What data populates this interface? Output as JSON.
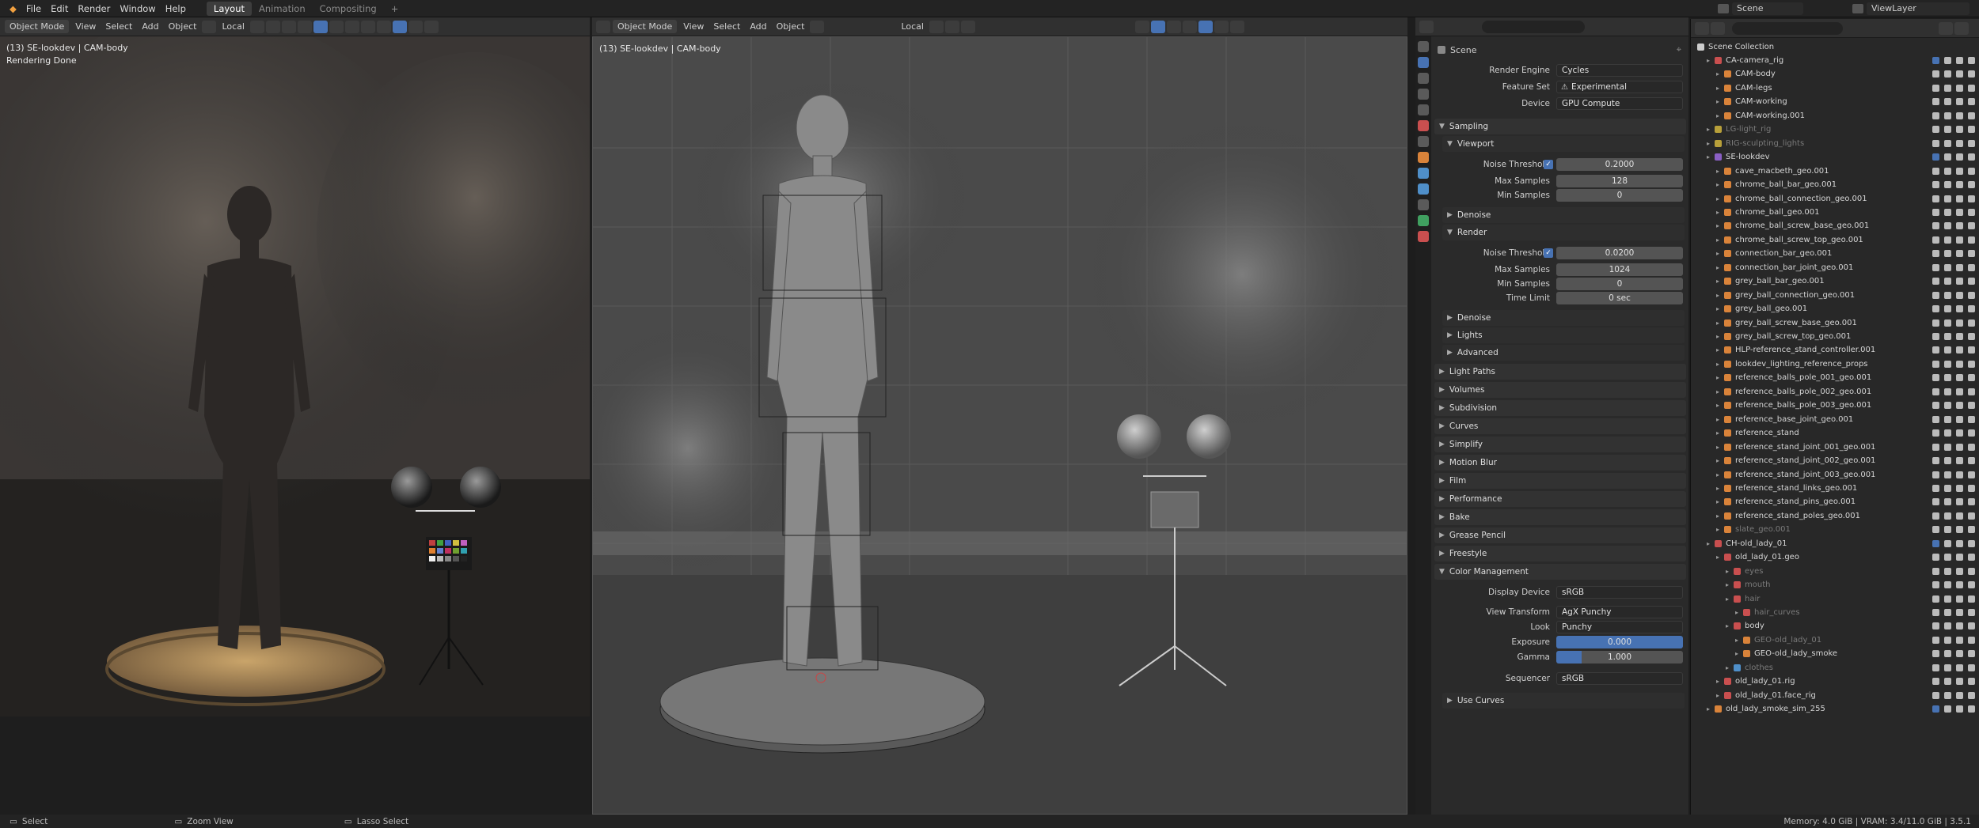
{
  "app": {
    "menus": [
      "File",
      "Edit",
      "Render",
      "Window",
      "Help"
    ],
    "workspaces": [
      "Layout",
      "Animation",
      "Compositing",
      "+"
    ],
    "active_workspace": "Layout",
    "scene_label": "Scene",
    "view_layer_label": "ViewLayer"
  },
  "viewport_left": {
    "mode": "Object Mode",
    "menus": [
      "View",
      "Select",
      "Add",
      "Object"
    ],
    "orientation": "Local",
    "overlay_title": "(13) SE-lookdev | CAM-body",
    "status_text": "Rendering Done"
  },
  "viewport_right": {
    "mode": "Object Mode",
    "menus": [
      "View",
      "Select",
      "Add",
      "Object"
    ],
    "orientation": "Local",
    "overlay_title": "(13) SE-lookdev | CAM-body"
  },
  "properties": {
    "scene_title": "Scene",
    "render_engine_label": "Render Engine",
    "render_engine": "Cycles",
    "feature_set_label": "Feature Set",
    "feature_set": "Experimental",
    "device_label": "Device",
    "device": "GPU Compute",
    "sampling": "Sampling",
    "viewport": "Viewport",
    "noise_threshold_label": "Noise Threshold",
    "vp_noise_threshold": "0.2000",
    "max_samples_label": "Max Samples",
    "vp_max_samples": "128",
    "min_samples_label": "Min Samples",
    "vp_min_samples": "0",
    "denoise": "Denoise",
    "render": "Render",
    "r_noise_threshold": "0.0200",
    "r_max_samples": "1024",
    "r_min_samples": "0",
    "time_limit_label": "Time Limit",
    "time_limit": "0 sec",
    "lights": "Lights",
    "advanced": "Advanced",
    "light_paths": "Light Paths",
    "volumes": "Volumes",
    "subdivision": "Subdivision",
    "curves": "Curves",
    "simplify": "Simplify",
    "motion_blur": "Motion Blur",
    "film": "Film",
    "performance": "Performance",
    "bake": "Bake",
    "grease_pencil": "Grease Pencil",
    "freestyle": "Freestyle",
    "color_management": "Color Management",
    "display_device_label": "Display Device",
    "display_device": "sRGB",
    "view_transform_label": "View Transform",
    "view_transform": "AgX Punchy",
    "look_label": "Look",
    "look": "Punchy",
    "exposure_label": "Exposure",
    "exposure": "0.000",
    "gamma_label": "Gamma",
    "gamma": "1.000",
    "sequencer_label": "Sequencer",
    "sequencer": "sRGB",
    "use_curves": "Use Curves"
  },
  "outliner": {
    "root": "Scene Collection",
    "items": [
      {
        "label": "CA-camera_rig",
        "level": 1,
        "color": "#c94f4f"
      },
      {
        "label": "CAM-body",
        "level": 2,
        "color": "#d9833a"
      },
      {
        "label": "CAM-legs",
        "level": 2,
        "color": "#d9833a"
      },
      {
        "label": "CAM-working",
        "level": 2,
        "color": "#d9833a"
      },
      {
        "label": "CAM-working.001",
        "level": 2,
        "color": "#d9833a"
      },
      {
        "label": "LG-light_rig",
        "level": 1,
        "color": "#b8a03a",
        "dim": true
      },
      {
        "label": "RIG-sculpting_lights",
        "level": 1,
        "color": "#b8a03a",
        "dim": true
      },
      {
        "label": "SE-lookdev",
        "level": 1,
        "color": "#8a5fc4"
      },
      {
        "label": "cave_macbeth_geo.001",
        "level": 2,
        "color": "#d9833a"
      },
      {
        "label": "chrome_ball_bar_geo.001",
        "level": 2,
        "color": "#d9833a"
      },
      {
        "label": "chrome_ball_connection_geo.001",
        "level": 2,
        "color": "#d9833a"
      },
      {
        "label": "chrome_ball_geo.001",
        "level": 2,
        "color": "#d9833a"
      },
      {
        "label": "chrome_ball_screw_base_geo.001",
        "level": 2,
        "color": "#d9833a"
      },
      {
        "label": "chrome_ball_screw_top_geo.001",
        "level": 2,
        "color": "#d9833a"
      },
      {
        "label": "connection_bar_geo.001",
        "level": 2,
        "color": "#d9833a"
      },
      {
        "label": "connection_bar_joint_geo.001",
        "level": 2,
        "color": "#d9833a"
      },
      {
        "label": "grey_ball_bar_geo.001",
        "level": 2,
        "color": "#d9833a"
      },
      {
        "label": "grey_ball_connection_geo.001",
        "level": 2,
        "color": "#d9833a"
      },
      {
        "label": "grey_ball_geo.001",
        "level": 2,
        "color": "#d9833a"
      },
      {
        "label": "grey_ball_screw_base_geo.001",
        "level": 2,
        "color": "#d9833a"
      },
      {
        "label": "grey_ball_screw_top_geo.001",
        "level": 2,
        "color": "#d9833a"
      },
      {
        "label": "HLP-reference_stand_controller.001",
        "level": 2,
        "color": "#d9833a"
      },
      {
        "label": "lookdev_lighting_reference_props",
        "level": 2,
        "color": "#d9833a"
      },
      {
        "label": "reference_balls_pole_001_geo.001",
        "level": 2,
        "color": "#d9833a"
      },
      {
        "label": "reference_balls_pole_002_geo.001",
        "level": 2,
        "color": "#d9833a"
      },
      {
        "label": "reference_balls_pole_003_geo.001",
        "level": 2,
        "color": "#d9833a"
      },
      {
        "label": "reference_base_joint_geo.001",
        "level": 2,
        "color": "#d9833a"
      },
      {
        "label": "reference_stand",
        "level": 2,
        "color": "#d9833a"
      },
      {
        "label": "reference_stand_joint_001_geo.001",
        "level": 2,
        "color": "#d9833a"
      },
      {
        "label": "reference_stand_joint_002_geo.001",
        "level": 2,
        "color": "#d9833a"
      },
      {
        "label": "reference_stand_joint_003_geo.001",
        "level": 2,
        "color": "#d9833a"
      },
      {
        "label": "reference_stand_links_geo.001",
        "level": 2,
        "color": "#d9833a"
      },
      {
        "label": "reference_stand_pins_geo.001",
        "level": 2,
        "color": "#d9833a"
      },
      {
        "label": "reference_stand_poles_geo.001",
        "level": 2,
        "color": "#d9833a"
      },
      {
        "label": "slate_geo.001",
        "level": 2,
        "color": "#d9833a",
        "dim": true
      },
      {
        "label": "CH-old_lady_01",
        "level": 1,
        "color": "#c94f4f"
      },
      {
        "label": "old_lady_01.geo",
        "level": 2,
        "color": "#c94f4f"
      },
      {
        "label": "eyes",
        "level": 3,
        "color": "#c94f4f",
        "dim": true
      },
      {
        "label": "mouth",
        "level": 3,
        "color": "#c94f4f",
        "dim": true
      },
      {
        "label": "hair",
        "level": 3,
        "color": "#c94f4f",
        "dim": true
      },
      {
        "label": "hair_curves",
        "level": 4,
        "color": "#c94f4f",
        "dim": true
      },
      {
        "label": "body",
        "level": 3,
        "color": "#c94f4f"
      },
      {
        "label": "GEO-old_lady_01",
        "level": 4,
        "color": "#d9833a",
        "dim": true
      },
      {
        "label": "GEO-old_lady_smoke",
        "level": 4,
        "color": "#d9833a"
      },
      {
        "label": "clothes",
        "level": 3,
        "color": "#4f8fc9",
        "dim": true
      },
      {
        "label": "old_lady_01.rig",
        "level": 2,
        "color": "#c94f4f"
      },
      {
        "label": "old_lady_01.face_rig",
        "level": 2,
        "color": "#c94f4f"
      },
      {
        "label": "old_lady_smoke_sim_255",
        "level": 1,
        "color": "#d9833a"
      }
    ]
  },
  "statusbar": {
    "select": "Select",
    "zoom": "Zoom View",
    "lasso": "Lasso Select",
    "memory": "Memory: 4.0 GiB | VRAM: 3.4/11.0 GiB | 3.5.1"
  }
}
